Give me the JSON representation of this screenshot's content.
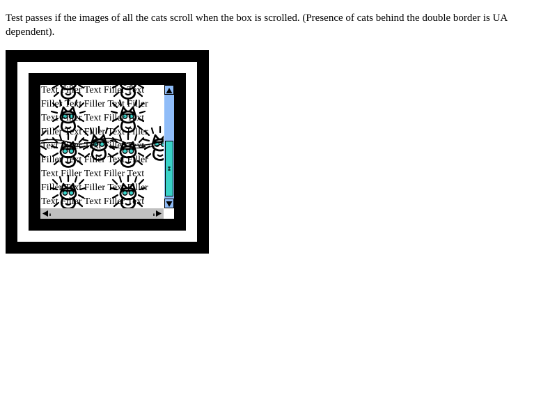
{
  "instructions": "Test passes if the images of all the cats scroll when the box is scrolled. (Presence of cats behind the double border is UA dependent).",
  "scroll_box": {
    "text_lines": [
      "Text Filler Text Filler Text",
      "Filler Text Filler Text Filler",
      "Text Filler Text Filler Text",
      "Filler Text Filler Text Filler",
      "Text Filler Text Filler Text",
      "Filler Text Filler Text Filler",
      "Text Filler Text Filler Text",
      "Filler Text Filler Text Filler",
      "Text Filler Text Filler Text"
    ],
    "scroll_up_icon": "arrow-up-icon",
    "scroll_down_icon": "arrow-down-icon",
    "scroll_left_icon": "arrow-left-icon",
    "scroll_right_icon": "arrow-right-icon",
    "cat_image_icon": "cat-icon"
  },
  "colors": {
    "border": "#000000",
    "vscroll_track": "#8fbcf8",
    "vscroll_thumb": "#39d2c8",
    "hscroll_track": "#c0c0c0",
    "cat_eye": "#39d2c8"
  }
}
